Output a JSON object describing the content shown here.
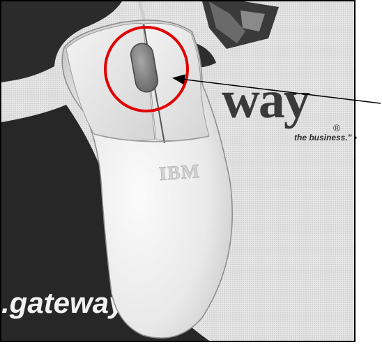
{
  "photo": {
    "brand_word": "way",
    "registered_mark": "®",
    "tagline": "the business.\" •",
    "mouse_logo": "IBM",
    "url_text": ".gateway."
  },
  "annotation": {
    "circle_color": "#e00000",
    "arrow_color": "#000000"
  },
  "icons": {
    "mouse": "computer-mouse-icon",
    "cow_box": "gateway-cow-box-logo"
  }
}
